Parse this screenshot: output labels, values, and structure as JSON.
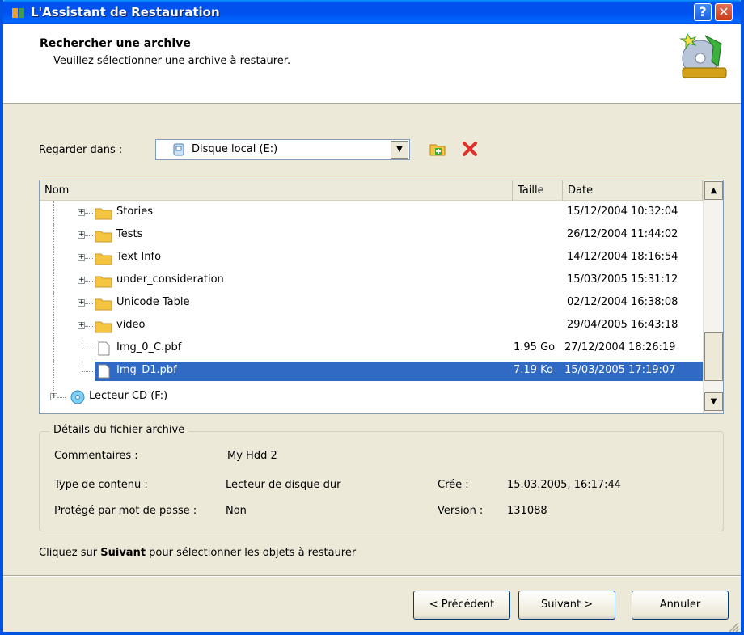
{
  "window": {
    "title": "L'Assistant de Restauration",
    "help_label": "?",
    "close_label": "✕"
  },
  "header": {
    "title": "Rechercher une archive",
    "subtitle": "Veuillez sélectionner une archive à restaurer."
  },
  "lookin": {
    "label": "Regarder dans :",
    "value": "Disque local (E:)"
  },
  "list": {
    "columns": [
      "Nom",
      "Taille",
      "Date"
    ],
    "rows": [
      {
        "name": "Stories",
        "size": "",
        "date": "15/12/2004 10:32:04",
        "type": "folder"
      },
      {
        "name": "Tests",
        "size": "",
        "date": "26/12/2004 11:44:02",
        "type": "folder"
      },
      {
        "name": "Text Info",
        "size": "",
        "date": "14/12/2004 18:16:54",
        "type": "folder"
      },
      {
        "name": "under_consideration",
        "size": "",
        "date": "15/03/2005 15:31:12",
        "type": "folder"
      },
      {
        "name": "Unicode Table",
        "size": "",
        "date": "02/12/2004 16:38:08",
        "type": "folder"
      },
      {
        "name": "video",
        "size": "",
        "date": "29/04/2005 16:43:18",
        "type": "folder"
      },
      {
        "name": "Img_0_C.pbf",
        "size": "1.95 Go",
        "date": "27/12/2004 18:26:19",
        "type": "file"
      },
      {
        "name": "Img_D1.pbf",
        "size": "7.19 Ko",
        "date": "15/03/2005 17:19:07",
        "type": "file",
        "selected": true
      },
      {
        "name": "Lecteur CD (F:)",
        "size": "",
        "date": "",
        "type": "cd"
      }
    ]
  },
  "details": {
    "group_title": "Détails du fichier archive",
    "comments_label": "Commentaires :",
    "comments_value": "My Hdd 2",
    "content_type_label": "Type de contenu :",
    "content_type_value": "Lecteur de disque dur",
    "created_label": "Crée :",
    "created_value": "15.03.2005, 16:17:44",
    "password_label": "Protégé par mot de passe :",
    "password_value": "Non",
    "version_label": "Version :",
    "version_value": "131088"
  },
  "hint": {
    "before": "Cliquez sur ",
    "bold": "Suivant",
    "after": " pour sélectionner les objets à restaurer"
  },
  "buttons": {
    "prev": "< Précédent",
    "next": "Suivant >",
    "cancel": "Annuler"
  },
  "colors": {
    "titlebar": "#0054e3",
    "selection": "#316ac5",
    "folder": "#f5c542",
    "dialog_bg": "#ece9d8"
  }
}
